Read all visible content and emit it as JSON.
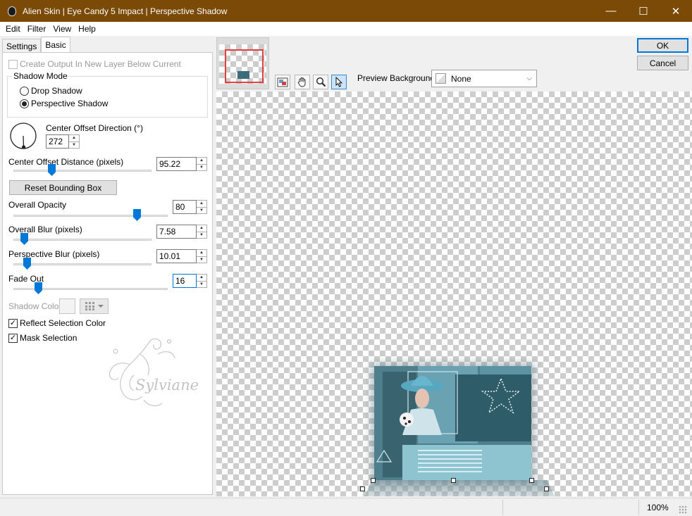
{
  "window": {
    "title": "Alien Skin | Eye Candy 5 Impact | Perspective Shadow",
    "minimize_glyph": "—",
    "maximize_glyph": "☐",
    "close_glyph": "✕"
  },
  "menu": [
    "Edit",
    "Filter",
    "View",
    "Help"
  ],
  "tabs": [
    "Settings",
    "Basic"
  ],
  "basic": {
    "create_output_label": "Create Output In New Layer Below Current",
    "create_output_checked": false,
    "shadow_mode_label": "Shadow Mode",
    "shadow_mode_options": [
      "Drop Shadow",
      "Perspective Shadow"
    ],
    "shadow_mode_selected": "Perspective Shadow",
    "center_offset_direction_label": "Center Offset Direction (°)",
    "center_offset_direction_value": "272",
    "center_offset_distance_label": "Center Offset Distance (pixels)",
    "center_offset_distance_value": "95.22",
    "center_offset_distance_level": 0.28,
    "reset_bounding_box_label": "Reset Bounding Box",
    "overall_opacity_label": "Overall Opacity",
    "overall_opacity_value": "80",
    "overall_opacity_level": 0.8,
    "overall_blur_label": "Overall Blur (pixels)",
    "overall_blur_value": "7.58",
    "overall_blur_level": 0.08,
    "perspective_blur_label": "Perspective Blur (pixels)",
    "perspective_blur_value": "10.01",
    "perspective_blur_level": 0.1,
    "fade_out_label": "Fade Out",
    "fade_out_value": "16",
    "fade_out_level": 0.16,
    "shadow_color_label": "Shadow Color",
    "reflect_selection_color_label": "Reflect Selection Color",
    "reflect_selection_color_checked": true,
    "mask_selection_label": "Mask Selection",
    "mask_selection_checked": true,
    "check_glyph": "✓"
  },
  "watermark_text": "Sylviane",
  "buttons": {
    "ok": "OK",
    "cancel": "Cancel"
  },
  "preview_toolbar": {
    "tools": [
      "preview-toggle-icon",
      "hand-icon",
      "zoom-icon",
      "pointer-icon"
    ],
    "active_tool": "pointer-icon",
    "background_label": "Preview Background:",
    "background_value": "None"
  },
  "status": {
    "zoom": "100%"
  },
  "colors": {
    "title_bar": "#7a4a06",
    "accent": "#0078d7",
    "thumbnail_frame": "#e04040"
  }
}
